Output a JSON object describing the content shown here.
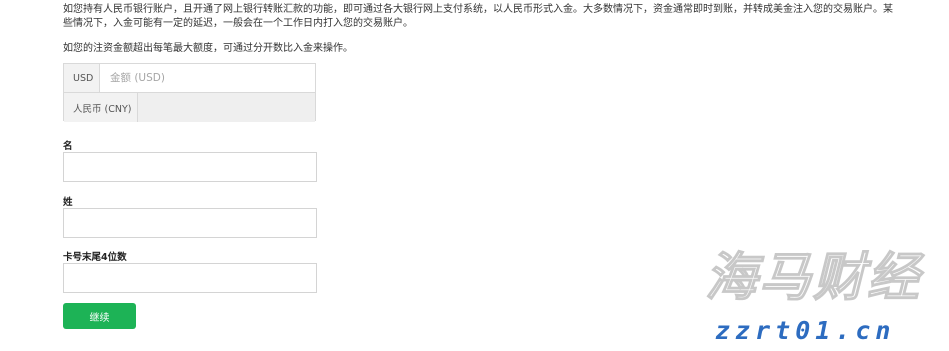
{
  "intro_text": "如您持有人民币银行账户，且开通了网上银行转账汇款的功能，即可通过各大银行网上支付系统，以人民币形式入金。大多数情况下，资金通常即时到账，并转成美金注入您的交易账户。某些情况下，入金可能有一定的延迟，一般会在一个工作日内打入您的交易账户。",
  "note_text": "如您的注资金额超出每笔最大额度，可通过分开数比入金来操作。",
  "amount": {
    "usd_label": "USD",
    "usd_placeholder": "金额 (USD)",
    "usd_value": "",
    "cny_label": "人民币 (CNY)",
    "cny_value": ""
  },
  "form": {
    "first_name_label": "名",
    "first_name_value": "",
    "last_name_label": "姓",
    "last_name_value": "",
    "card_last4_label": "卡号末尾4位数",
    "card_last4_value": ""
  },
  "continue_label": "继续",
  "watermark": {
    "title": "海马财经",
    "url": "zzrt01.cn"
  },
  "colors": {
    "button_green": "#1db356",
    "watermark_blue": "#2d6cc0"
  }
}
